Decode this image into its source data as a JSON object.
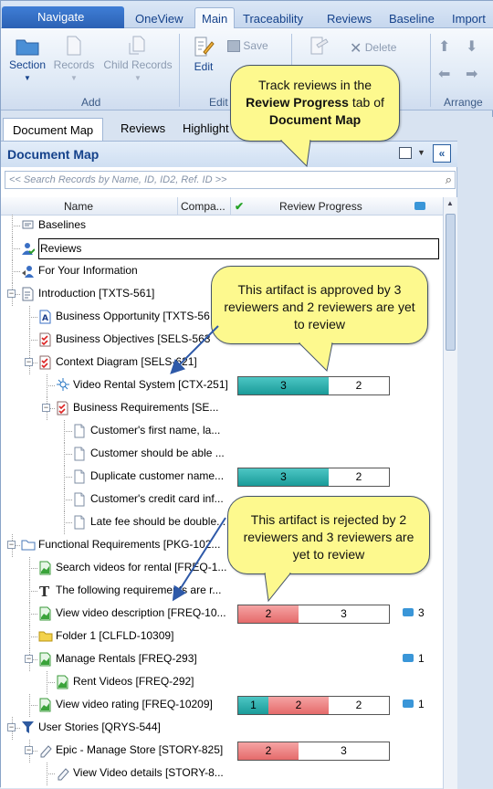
{
  "ribbon": {
    "navigate_label": "Navigate",
    "tabs": [
      {
        "label": "OneView"
      },
      {
        "label": "Main"
      },
      {
        "label": "Traceability"
      },
      {
        "label": "Reviews"
      },
      {
        "label": "Baseline"
      },
      {
        "label": "Import"
      }
    ],
    "buttons": {
      "section": "Section",
      "records": "Records",
      "child_records": "Child Records",
      "edit": "Edit",
      "save": "Save",
      "delete": "Delete"
    },
    "groups": {
      "add": "Add",
      "edit": "Edit",
      "arrange": "Arrange"
    }
  },
  "panel": {
    "tabs": [
      {
        "label": "Document Map"
      },
      {
        "label": "Reviews"
      },
      {
        "label": "Highlight"
      }
    ],
    "title": "Document Map",
    "search_placeholder": "<< Search Records by Name, ID, ID2, Ref. ID >>",
    "columns": {
      "name": "Name",
      "company": "Compa...",
      "review_progress": "Review Progress"
    }
  },
  "tree": [
    {
      "label": "Baselines",
      "icon": "baselines-icon",
      "depth": 0
    },
    {
      "label": "Reviews",
      "icon": "reviews-icon",
      "depth": 0,
      "selected": true
    },
    {
      "label": "For Your Information",
      "icon": "fyi-icon",
      "depth": 0
    },
    {
      "label": "Introduction [TXTS-561]",
      "icon": "section-icon",
      "depth": 0,
      "expander": "-"
    },
    {
      "label": "Business Opportunity [TXTS-56",
      "icon": "text-doc-icon",
      "depth": 1
    },
    {
      "label": "Business Objectives [SELS-563",
      "icon": "checklist-icon",
      "depth": 1
    },
    {
      "label": "Context Diagram [SELS-621]",
      "icon": "checklist-icon",
      "depth": 1,
      "expander": "-"
    },
    {
      "label": "Video Rental System [CTX-251]",
      "icon": "context-icon",
      "depth": 2,
      "review": {
        "approved": 3,
        "rejected": 0,
        "pending": 2
      }
    },
    {
      "label": "Business Requirements [SE...",
      "icon": "checklist-icon",
      "depth": 2,
      "expander": "-"
    },
    {
      "label": "Customer's first name, la...",
      "icon": "doc-icon",
      "depth": 3
    },
    {
      "label": "Customer should be able ...",
      "icon": "doc-icon",
      "depth": 3
    },
    {
      "label": "Duplicate customer name...",
      "icon": "doc-icon",
      "depth": 3,
      "review": {
        "approved": 3,
        "rejected": 0,
        "pending": 2
      }
    },
    {
      "label": "Customer's credit card inf...",
      "icon": "doc-icon",
      "depth": 3
    },
    {
      "label": "Late fee should be double...",
      "icon": "doc-icon",
      "depth": 3
    },
    {
      "label": "Functional Requirements [PKG-102...",
      "icon": "folder-icon",
      "depth": 0,
      "expander": "-"
    },
    {
      "label": "Search videos for rental [FREQ-1...",
      "icon": "green-doc-icon",
      "depth": 1
    },
    {
      "label": "The following requirements are r...",
      "icon": "text-t-icon",
      "depth": 1
    },
    {
      "label": "View video description [FREQ-10...",
      "icon": "green-doc-icon",
      "depth": 1,
      "review": {
        "approved": 0,
        "rejected": 2,
        "pending": 3
      },
      "comments": "3"
    },
    {
      "label": "Folder 1 [CLFLD-10309]",
      "icon": "yellow-folder-icon",
      "depth": 1
    },
    {
      "label": "Manage Rentals [FREQ-293]",
      "icon": "green-doc-icon",
      "depth": 1,
      "expander": "-",
      "comments": "1"
    },
    {
      "label": "Rent Videos [FREQ-292]",
      "icon": "green-doc-icon",
      "depth": 2
    },
    {
      "label": "View video rating [FREQ-10209]",
      "icon": "green-doc-icon",
      "depth": 1,
      "review": {
        "approved": 1,
        "rejected": 2,
        "pending": 2
      },
      "comments": "1"
    },
    {
      "label": "User Stories [QRYS-544]",
      "icon": "filter-icon",
      "depth": 0,
      "expander": "-"
    },
    {
      "label": "Epic - Manage Store [STORY-825]",
      "icon": "pencil-icon",
      "depth": 1,
      "expander": "-",
      "review": {
        "approved": 0,
        "rejected": 2,
        "pending": 3
      }
    },
    {
      "label": "View Video details [STORY-8...",
      "icon": "pencil-icon",
      "depth": 2
    }
  ],
  "callouts": {
    "tab": {
      "pre": "Track reviews in the",
      "bold1": "Review Progress",
      "mid": "tab of",
      "bold2": "Document Map"
    },
    "approved": "This artifact is approved by 3 reviewers and 2 reviewers are yet to review",
    "rejected": "This artifact is rejected by 2 reviewers and 3 reviewers are yet to review"
  },
  "colors": {
    "approved": "#1fa3a1",
    "rejected": "#e97878",
    "pending": "#ffffff",
    "callout": "#fdf98e"
  }
}
